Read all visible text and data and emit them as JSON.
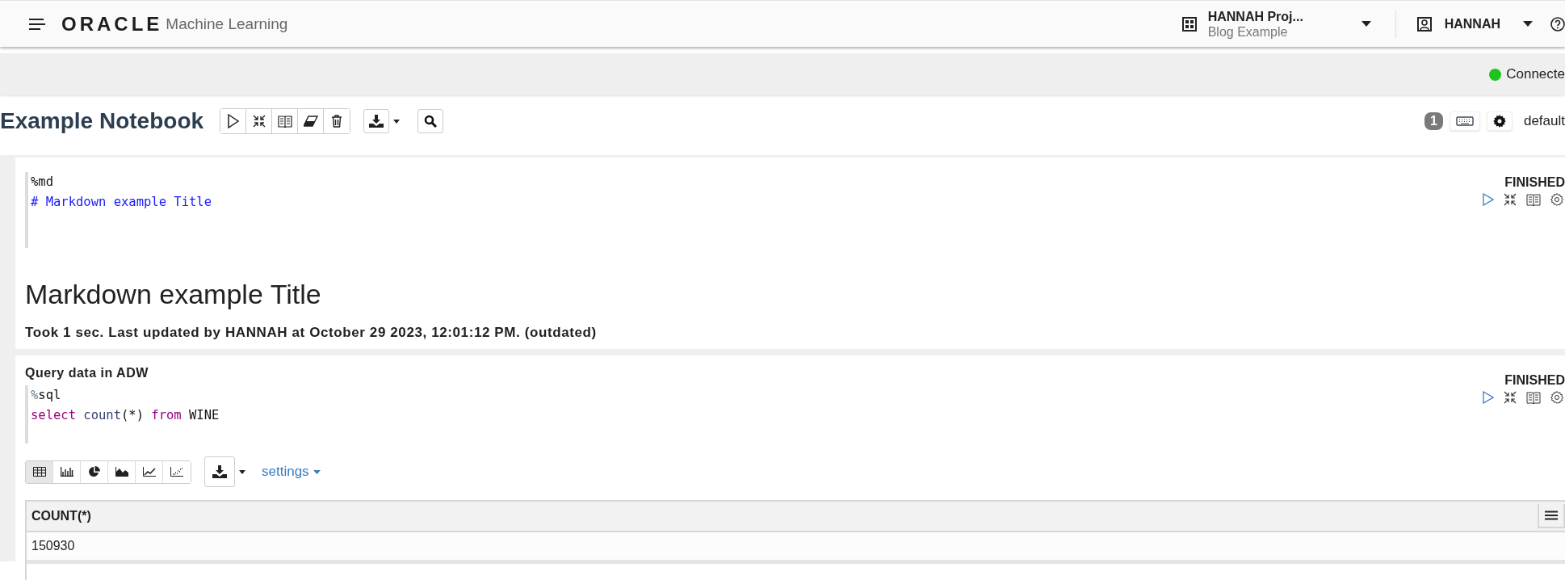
{
  "header": {
    "product_logo": "ORACLE",
    "product_name": "Machine Learning",
    "project": {
      "name": "HANNAH Proj...",
      "workspace": "Blog Example"
    },
    "user": "HANNAH"
  },
  "status": {
    "connection": "Connecte",
    "color": "#1ec31e"
  },
  "notebook": {
    "title": "Example Notebook",
    "badge": "1",
    "interpreter": "default"
  },
  "paragraphs": [
    {
      "status": "FINISHED",
      "code": [
        [
          {
            "kind": "plain",
            "text": "%md"
          }
        ],
        [
          {
            "kind": "heading",
            "text": "# Markdown example Title"
          }
        ]
      ],
      "output": {
        "kind": "markdown",
        "heading": "Markdown example Title",
        "footer": "Took 1 sec. Last updated by HANNAH at October 29 2023, 12:01:12 PM. (outdated)"
      }
    },
    {
      "title": "Query data in ADW",
      "status": "FINISHED",
      "code": [
        [
          {
            "kind": "directive",
            "text": "%"
          },
          {
            "kind": "plain",
            "text": "sql"
          }
        ],
        [
          {
            "kind": "keyword",
            "text": "select"
          },
          {
            "kind": "function",
            "text": " count"
          },
          {
            "kind": "plain",
            "text": "(*) "
          },
          {
            "kind": "keyword",
            "text": "from"
          },
          {
            "kind": "plain",
            "text": " WINE"
          }
        ]
      ],
      "output": {
        "kind": "table",
        "views": [
          {
            "kind": "table",
            "selected": true
          },
          {
            "kind": "bar",
            "selected": false
          },
          {
            "kind": "pie",
            "selected": false
          },
          {
            "kind": "area",
            "selected": false
          },
          {
            "kind": "line",
            "selected": false
          },
          {
            "kind": "scatter",
            "selected": false
          }
        ],
        "settings_label": "settings",
        "columns": [
          "COUNT(*)"
        ],
        "rows": [
          [
            "150930"
          ]
        ]
      }
    }
  ]
}
